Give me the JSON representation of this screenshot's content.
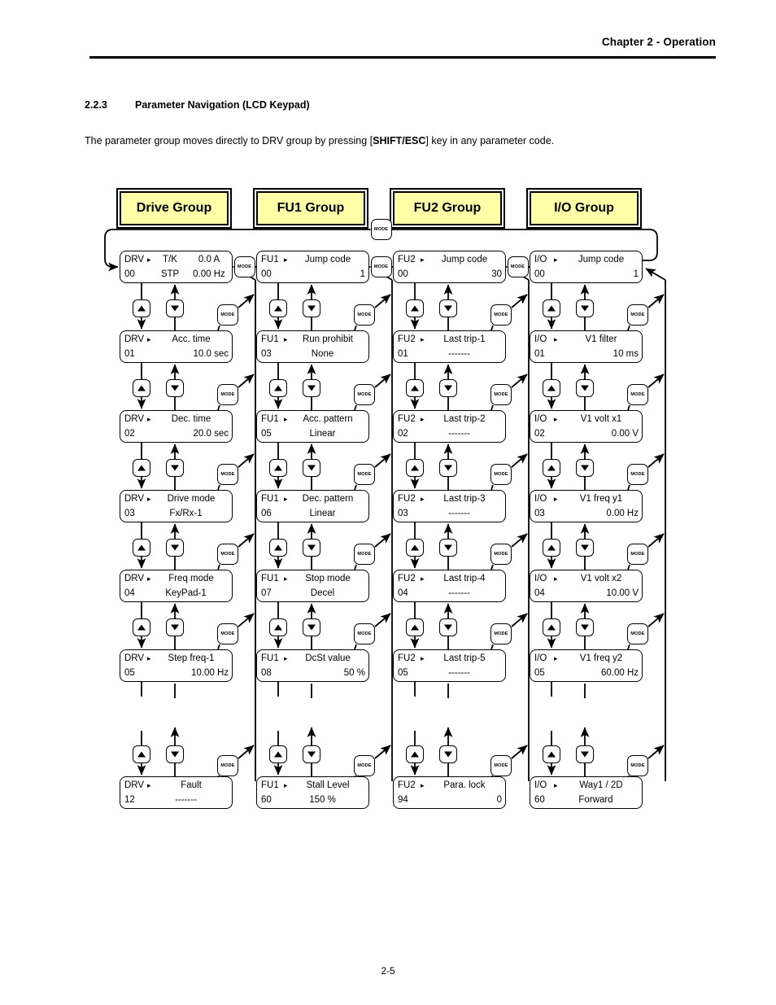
{
  "page": {
    "header": "Chapter 2 - Operation",
    "section_number": "2.2.3",
    "section_title": "Parameter Navigation (LCD Keypad)",
    "intro_before": "The parameter group moves directly to DRV group by pressing [",
    "intro_bold": "SHIFT/ESC",
    "intro_after": "] key in any parameter code.",
    "footer": "2-5"
  },
  "keys": {
    "mode_label": "MODE",
    "up_icon": "triangle-up-icon",
    "down_icon": "triangle-down-icon",
    "pointer_glyph": "▸"
  },
  "colors": {
    "group_header_fill": "#ffffa8",
    "line": "#000000",
    "page_background": "#ffffff"
  },
  "groups": [
    {
      "id": "drive",
      "header": "Drive Group",
      "prefix": "DRV",
      "boxes": [
        {
          "code": "00",
          "name": "T/K",
          "value": "0.0 A",
          "name2": "STP",
          "value2": "0.00 Hz",
          "two_line_status": true
        },
        {
          "code": "01",
          "name": "Acc. time",
          "value": "10.0 sec"
        },
        {
          "code": "02",
          "name": "Dec. time",
          "value": "20.0 sec"
        },
        {
          "code": "03",
          "name": "Drive mode",
          "value": "Fx/Rx-1",
          "centered": true
        },
        {
          "code": "04",
          "name": "Freq mode",
          "value": "KeyPad-1",
          "centered": true
        },
        {
          "code": "05",
          "name": "Step freq-1",
          "value": "10.00 Hz"
        },
        {
          "code": "12",
          "name": "Fault",
          "value": "-------",
          "centered": true
        }
      ]
    },
    {
      "id": "fu1",
      "header": "FU1 Group",
      "prefix": "FU1",
      "boxes": [
        {
          "code": "00",
          "name": "Jump code",
          "value": "1"
        },
        {
          "code": "03",
          "name": "Run prohibit",
          "value": "None",
          "centered": true
        },
        {
          "code": "05",
          "name": "Acc. pattern",
          "value": "Linear",
          "centered": true
        },
        {
          "code": "06",
          "name": "Dec. pattern",
          "value": "Linear",
          "centered": true
        },
        {
          "code": "07",
          "name": "Stop mode",
          "value": "Decel",
          "centered": true
        },
        {
          "code": "08",
          "name": "DcSt value",
          "value": "50 %"
        },
        {
          "code": "60",
          "name": "Stall Level",
          "value": "150 %",
          "centered": true
        }
      ]
    },
    {
      "id": "fu2",
      "header": "FU2 Group",
      "prefix": "FU2",
      "boxes": [
        {
          "code": "00",
          "name": "Jump code",
          "value": "30"
        },
        {
          "code": "01",
          "name": "Last trip-1",
          "value": "-------",
          "centered": true
        },
        {
          "code": "02",
          "name": "Last trip-2",
          "value": "-------",
          "centered": true
        },
        {
          "code": "03",
          "name": "Last trip-3",
          "value": "-------",
          "centered": true
        },
        {
          "code": "04",
          "name": "Last trip-4",
          "value": "-------",
          "centered": true
        },
        {
          "code": "05",
          "name": "Last trip-5",
          "value": "-------",
          "centered": true
        },
        {
          "code": "94",
          "name": "Para. lock",
          "value": "0"
        }
      ]
    },
    {
      "id": "io",
      "header": "I/O Group",
      "prefix": "I/O",
      "boxes": [
        {
          "code": "00",
          "name": "Jump code",
          "value": "1"
        },
        {
          "code": "01",
          "name": "V1 filter",
          "value": "10 ms"
        },
        {
          "code": "02",
          "name": "V1 volt x1",
          "value": "0.00 V"
        },
        {
          "code": "03",
          "name": "V1 freq y1",
          "value": "0.00 Hz"
        },
        {
          "code": "04",
          "name": "V1 volt x2",
          "value": "10.00 V"
        },
        {
          "code": "05",
          "name": "V1 freq y2",
          "value": "60.00 Hz"
        },
        {
          "code": "60",
          "name": "Way1 / 2D",
          "value": "Forward",
          "centered": true
        }
      ]
    }
  ]
}
